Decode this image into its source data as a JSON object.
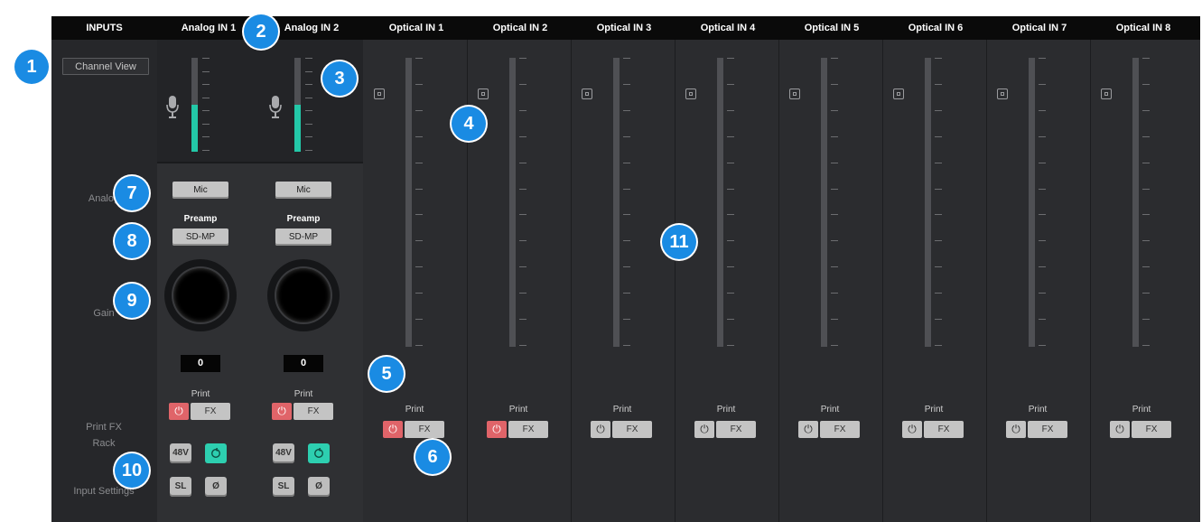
{
  "header": {
    "inputs_label": "INPUTS",
    "channels": [
      "Analog IN 1",
      "Analog IN 2",
      "Optical IN 1",
      "Optical IN 2",
      "Optical IN 3",
      "Optical IN 4",
      "Optical IN 5",
      "Optical IN 6",
      "Optical IN 7",
      "Optical IN 8"
    ]
  },
  "sidebar": {
    "channel_view": "Channel View",
    "analog": "Analog",
    "gain": "Gain",
    "print_fx_rack": "Print FX\nRack",
    "input_settings": "Input Settings"
  },
  "analog": {
    "type_label": "Mic",
    "preamp_label": "Preamp",
    "preamp_value": "SD-MP",
    "gain_values": [
      "0",
      "0"
    ],
    "meter_level": 0.5,
    "btn_48v": "48V",
    "btn_sl": "SL",
    "btn_phase": "Ø"
  },
  "print": {
    "label": "Print",
    "fx": "FX",
    "power_symbol": "⏻",
    "power_on": [
      true,
      true,
      true,
      true,
      false,
      false,
      false,
      false,
      false,
      false
    ]
  },
  "badges": [
    "1",
    "2",
    "3",
    "4",
    "5",
    "6",
    "7",
    "8",
    "9",
    "10",
    "11"
  ],
  "colors": {
    "accent_teal": "#23c8a8",
    "power_red": "#e06469",
    "badge_blue": "#1a8be3"
  }
}
